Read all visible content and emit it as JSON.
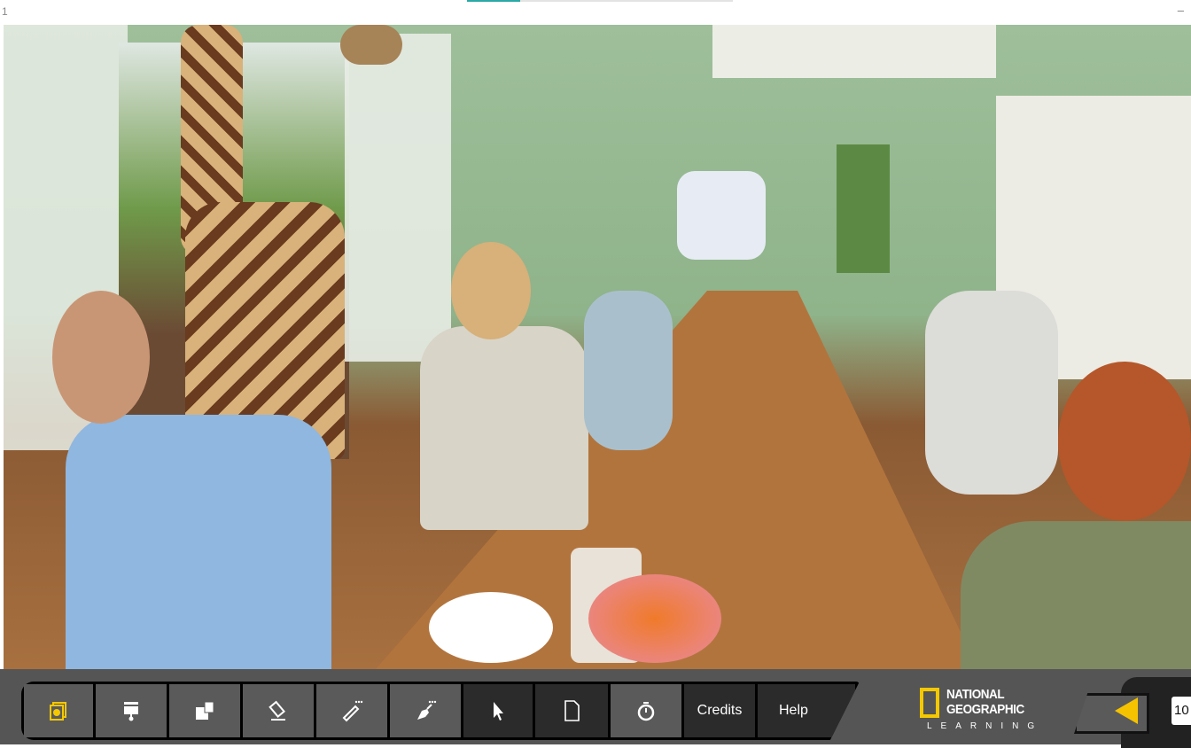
{
  "header": {
    "page_number": "1",
    "progress_percent": 20,
    "minimize_label": "–"
  },
  "photo": {
    "alt": "Guests having breakfast in a green dining room while a giraffe leans in through an open window"
  },
  "toolbar": {
    "items": [
      {
        "name": "media-gallery",
        "icon": "media-icon"
      },
      {
        "name": "spotlight",
        "icon": "spotlight-icon"
      },
      {
        "name": "reveal",
        "icon": "reveal-icon"
      },
      {
        "name": "eraser",
        "icon": "eraser-icon"
      },
      {
        "name": "pencil",
        "icon": "pencil-icon"
      },
      {
        "name": "pen",
        "icon": "pen-icon"
      },
      {
        "name": "select",
        "icon": "cursor-icon"
      },
      {
        "name": "page",
        "icon": "page-icon"
      },
      {
        "name": "timer",
        "icon": "stopwatch-icon"
      }
    ],
    "credits_label": "Credits",
    "help_label": "Help"
  },
  "logo": {
    "line1": "NATIONAL",
    "line2": "GEOGRAPHIC",
    "line3": "LEARNING"
  },
  "nav": {
    "page_box": "10"
  },
  "colors": {
    "accent": "#f5c200",
    "progress": "#2aa9a6",
    "toolbar_bg": "#555555"
  }
}
